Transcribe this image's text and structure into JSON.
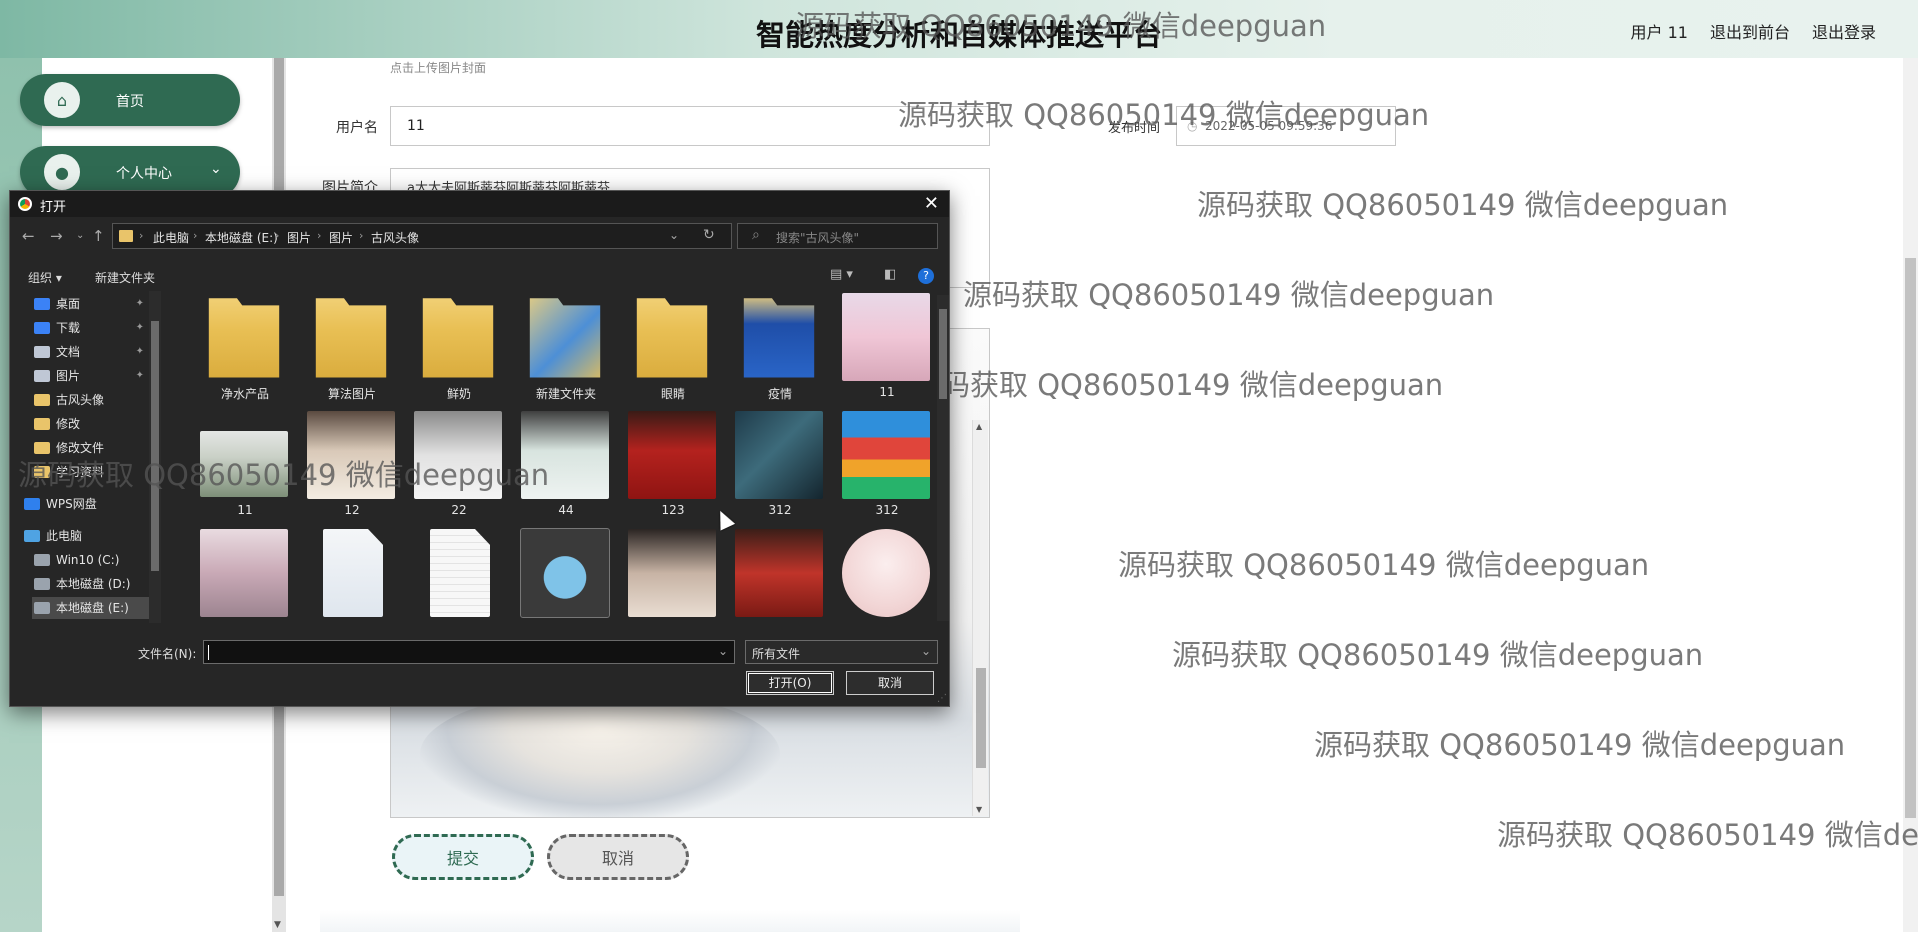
{
  "header": {
    "title": "智能热度分析和自媒体推送平台",
    "links": [
      "用户 11",
      "退出到前台",
      "退出登录"
    ]
  },
  "sidebar": {
    "items": [
      {
        "label": "首页",
        "icon": "home-icon"
      },
      {
        "label": "个人中心",
        "icon": "user-icon",
        "chevron": "⌄"
      }
    ]
  },
  "form": {
    "cover_hint": "点击上传图片封面",
    "username_label": "用户名",
    "username_value": "11",
    "publish_time_label": "发布时间",
    "publish_time_value": "2022-05-05 09:59:36",
    "intro_label": "图片简介",
    "intro_value": "a大大夫阿斯蒂芬阿斯蒂芬阿斯蒂芬",
    "submit_label": "提交",
    "cancel_label": "取消"
  },
  "watermark": "源码获取 QQ86050149 微信deepguan",
  "dialog": {
    "title": "打开",
    "breadcrumbs": [
      "此电脑",
      "本地磁盘 (E:)",
      "图片",
      "图片",
      "古风头像"
    ],
    "search_placeholder": "搜索\"古风头像\"",
    "organize_label": "组织 ▾",
    "new_folder_label": "新建文件夹",
    "tree": [
      {
        "label": "桌面",
        "pinned": true,
        "color": "#3b82f6"
      },
      {
        "label": "下载",
        "pinned": true,
        "color": "#3b82f6"
      },
      {
        "label": "文档",
        "pinned": true,
        "color": "#bfc7d5"
      },
      {
        "label": "图片",
        "pinned": true,
        "color": "#bfc7d5"
      },
      {
        "label": "古风头像",
        "pinned": false,
        "color": "#e9c46a"
      },
      {
        "label": "修改",
        "pinned": false,
        "color": "#e9c46a"
      },
      {
        "label": "修改文件",
        "pinned": false,
        "color": "#e9c46a"
      },
      {
        "label": "学习资料",
        "pinned": false,
        "color": "#e9c46a"
      },
      {
        "label": "WPS网盘",
        "pinned": false,
        "color": "#2f80ed"
      },
      {
        "label": "此电脑",
        "pinned": false,
        "color": "#4fa3e3"
      },
      {
        "label": "Win10 (C:)",
        "pinned": false,
        "color": "#9aa3ad"
      },
      {
        "label": "本地磁盘 (D:)",
        "pinned": false,
        "color": "#9aa3ad"
      },
      {
        "label": "本地磁盘 (E:)",
        "pinned": false,
        "color": "#9aa3ad"
      }
    ],
    "files": [
      {
        "name": "净水产品",
        "kind": "folder"
      },
      {
        "name": "算法图片",
        "kind": "folder"
      },
      {
        "name": "鲜奶",
        "kind": "folder"
      },
      {
        "name": "新建文件夹",
        "kind": "folder"
      },
      {
        "name": "眼睛",
        "kind": "folder"
      },
      {
        "name": "疫情",
        "kind": "folder"
      },
      {
        "name": "11",
        "kind": "image"
      },
      {
        "name": "11",
        "kind": "image"
      },
      {
        "name": "12",
        "kind": "image"
      },
      {
        "name": "22",
        "kind": "image"
      },
      {
        "name": "44",
        "kind": "image"
      },
      {
        "name": "123",
        "kind": "image"
      },
      {
        "name": "312",
        "kind": "image"
      },
      {
        "name": "312",
        "kind": "archive"
      },
      {
        "name": "",
        "kind": "image"
      },
      {
        "name": "",
        "kind": "video"
      },
      {
        "name": "",
        "kind": "doc"
      },
      {
        "name": "",
        "kind": "pic"
      },
      {
        "name": "",
        "kind": "image"
      },
      {
        "name": "",
        "kind": "image"
      },
      {
        "name": "",
        "kind": "image"
      }
    ],
    "filename_label": "文件名(N):",
    "filename_value": "",
    "filetype_value": "所有文件",
    "open_label": "打开(O)",
    "cancel_label": "取消"
  }
}
